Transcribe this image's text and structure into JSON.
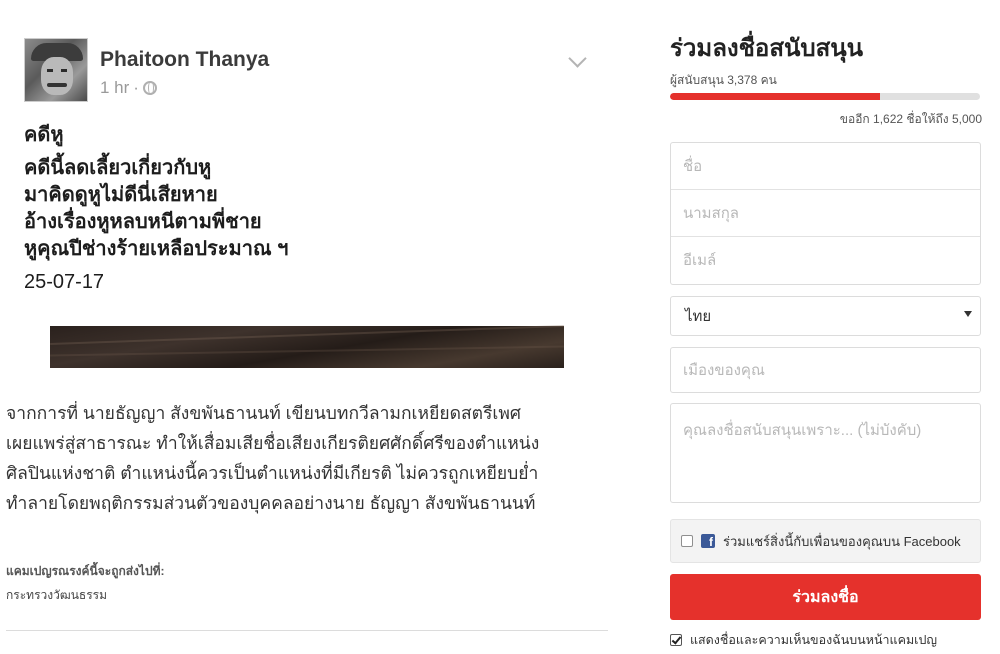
{
  "post": {
    "author": "Phaitoon Thanya",
    "time": "1 hr",
    "separator": "·",
    "poem_title": "คดีหู",
    "poem_lines": [
      "คดีนี้ลดเลี้ยวเกี่ยวกับหู",
      "มาคิดดูหูไม่ดีนี่เสียหาย",
      "อ้างเรื่องหูหลบหนีตามพี่ชาย",
      "หูคุณปีช่างร้ายเหลือประมาณ ฯ"
    ],
    "date": "25-07-17"
  },
  "description_lines": [
    "จากการที่ นายธัญญา สังขพันธานนท์ เขียนบทกวีลามกเหยียดสตรีเพศ",
    "เผยแพร่สู่สาธารณะ ทำให้เสื่อมเสียชื่อเสียงเกียรติยศศักดิ์ศรีของตำแหน่ง",
    "ศิลปินแห่งชาติ ตำแหน่งนี้ควรเป็นตำแหน่งที่มีเกียรติ ไม่ควรถูกเหยียบย่ำ",
    "ทำลายโดยพฤติกรรมส่วนตัวของบุคคลอย่างนาย ธัญญา สังขพันธานนท์"
  ],
  "recipient": {
    "label": "แคมเปญรณรงค์นี้จะถูกส่งไปที่:",
    "target": "กระทรวงวัฒนธรรม"
  },
  "sign": {
    "title": "ร่วมลงชื่อสนับสนุน",
    "supporters": "ผู้สนับสนุน 3,378 คน",
    "progress_fraction": 0.676,
    "remaining": "ขออีก 1,622 ชื่อให้ถึง 5,000",
    "placeholders": {
      "first_name": "ชื่อ",
      "last_name": "นามสกุล",
      "email": "อีเมล์",
      "city": "เมืองของคุณ",
      "reason": "คุณลงชื่อสนับสนุนเพราะ... (ไม่บังคับ)"
    },
    "country": "ไทย",
    "share_label": "ร่วมแชร์สิ่งนี้กับเพื่อนของคุณบน Facebook",
    "button": "ร่วมลงชื่อ",
    "display_label": "แสดงชื่อและความเห็นของฉันบนหน้าแคมเปญ"
  },
  "colors": {
    "accent": "#e5312c",
    "facebook": "#3b5998"
  },
  "icons": {
    "globe": "globe-icon",
    "chevron": "chevron-down-icon",
    "facebook": "facebook-icon"
  }
}
